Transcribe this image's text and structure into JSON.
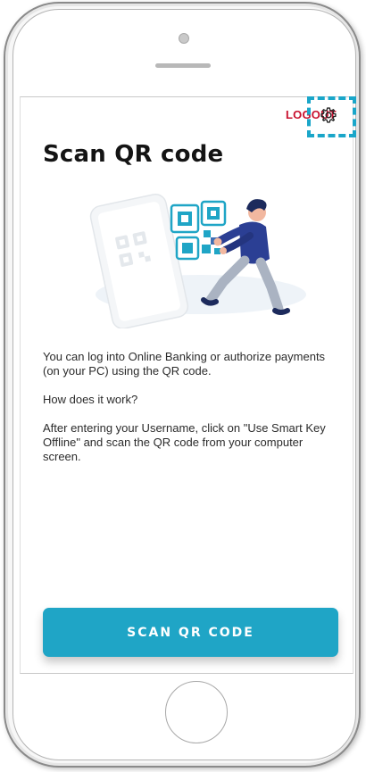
{
  "header": {
    "logout_label": "LOGOUT"
  },
  "icons": {
    "settings": "gear-icon"
  },
  "main": {
    "title": "Scan QR code",
    "paragraph1": "You can log into Online Banking or authorize payments (on your PC) using the QR code.",
    "paragraph2": "How does it work?",
    "paragraph3": "After entering your Username, click on \"Use Smart Key Offline\" and scan the QR code from your computer screen."
  },
  "actions": {
    "scan_button_label": "SCAN QR CODE"
  },
  "colors": {
    "accent": "#1fa5c6",
    "logout": "#c8102e",
    "highlight": "#1aa6c9",
    "title": "#141414"
  }
}
